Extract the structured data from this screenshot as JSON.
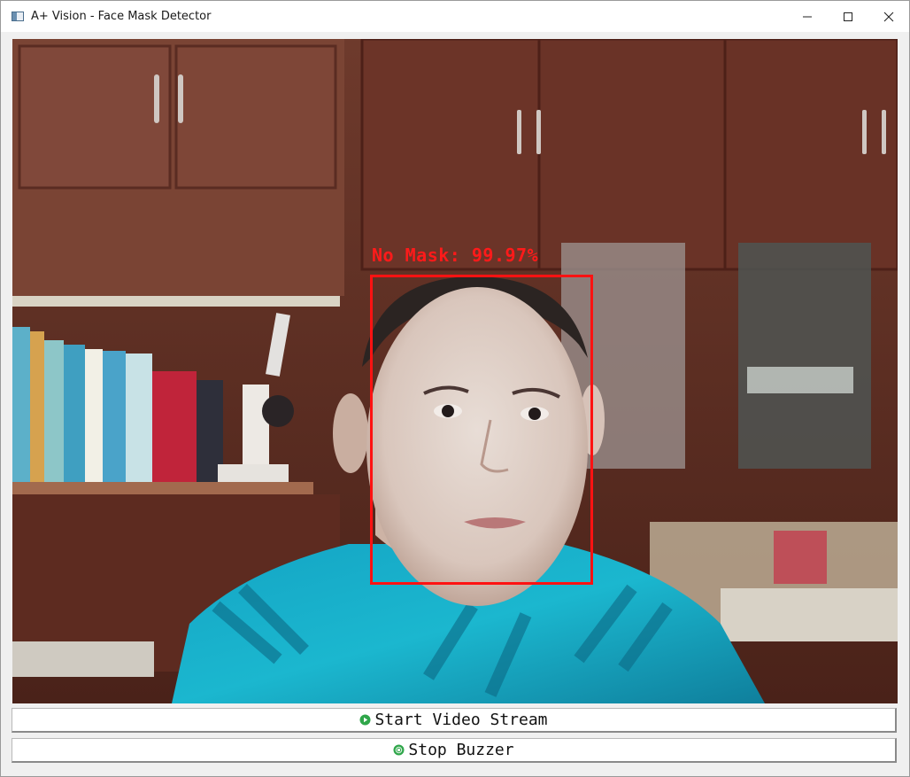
{
  "window": {
    "title": "A+ Vision - Face Mask Detector",
    "minimize_glyph": "—",
    "maximize_glyph": "☐",
    "close_glyph": "✕"
  },
  "video": {
    "detection_label": "No Mask: 99.97%",
    "detection_color": "#ff1212"
  },
  "controls": {
    "start_label": "Start Video Stream",
    "start_icon": "play-circle-icon",
    "stop_label": "Stop Buzzer",
    "stop_icon": "stop-circle-icon",
    "icon_color": "#2fa64a"
  }
}
